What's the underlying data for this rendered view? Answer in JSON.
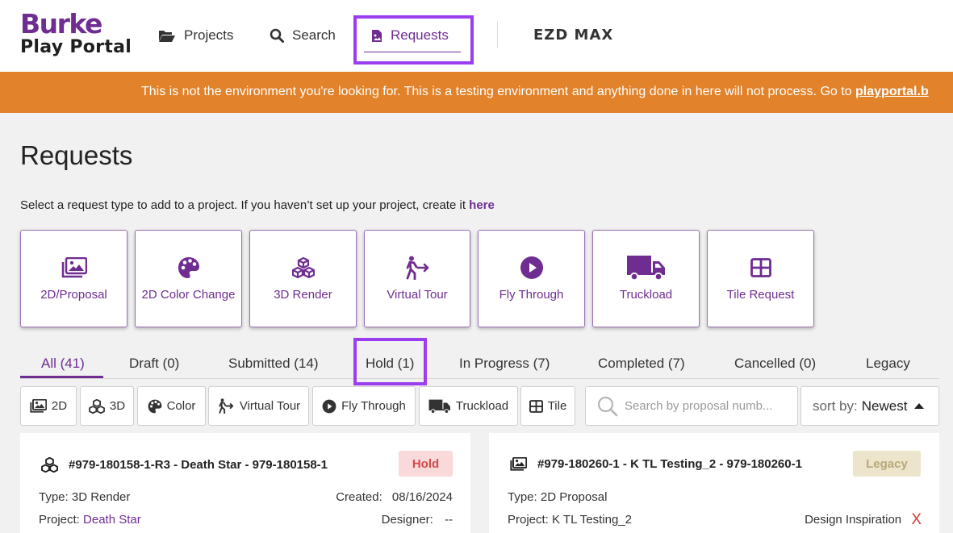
{
  "header": {
    "logo_top": "Burke",
    "logo_bottom": "Play Portal",
    "nav": {
      "projects": "Projects",
      "search": "Search",
      "requests": "Requests"
    },
    "partner_logo": "EZD MAX"
  },
  "banner": {
    "text": "This is not the environment you're looking for. This is a testing environment and anything done in here will not process. Go to ",
    "link": "playportal.b"
  },
  "page": {
    "title": "Requests",
    "intro_text": "Select a request type to add to a project. If you haven’t set up your project, create it ",
    "intro_link": "here"
  },
  "request_types": [
    {
      "label": "2D/Proposal",
      "icon": "image-gallery-icon"
    },
    {
      "label": "2D Color Change",
      "icon": "palette-icon"
    },
    {
      "label": "3D Render",
      "icon": "cubes-icon"
    },
    {
      "label": "Virtual Tour",
      "icon": "walking-person-icon"
    },
    {
      "label": "Fly Through",
      "icon": "play-circle-icon"
    },
    {
      "label": "Truckload",
      "icon": "truck-icon"
    },
    {
      "label": "Tile Request",
      "icon": "tile-grid-icon"
    }
  ],
  "tabs": [
    {
      "label": "All (41)",
      "active": true
    },
    {
      "label": "Draft (0)"
    },
    {
      "label": "Submitted (14)"
    },
    {
      "label": "Hold (1)"
    },
    {
      "label": "In Progress (7)"
    },
    {
      "label": "Completed (7)"
    },
    {
      "label": "Cancelled (0)"
    },
    {
      "label": "Legacy"
    }
  ],
  "filters": [
    {
      "label": "2D",
      "icon": "image-gallery-icon"
    },
    {
      "label": "3D",
      "icon": "cubes-icon"
    },
    {
      "label": "Color",
      "icon": "palette-icon"
    },
    {
      "label": "Virtual Tour",
      "icon": "walking-person-icon"
    },
    {
      "label": "Fly Through",
      "icon": "play-circle-icon"
    },
    {
      "label": "Truckload",
      "icon": "truck-icon"
    },
    {
      "label": "Tile",
      "icon": "tile-grid-icon"
    }
  ],
  "search": {
    "placeholder": "Search by proposal numb...",
    "value": ""
  },
  "sort": {
    "label": "sort by:",
    "value": "Newest"
  },
  "requests": [
    {
      "title": "#979-180158-1-R3 - Death Star - 979-180158-1",
      "status": "Hold",
      "type_label": "Type: 3D Render",
      "created_label": "Created:",
      "created_value": "08/16/2024",
      "project_label": "Project:",
      "project_value": "Death Star",
      "designer_label": "Designer:",
      "designer_value": "--"
    },
    {
      "title": "#979-180260-1 - K TL Testing_2 - 979-180260-1",
      "status": "Legacy",
      "type_label": "Type: 2D Proposal",
      "project_label": "Project:",
      "project_value": "K TL Testing_2",
      "design_inspiration_label": "Design Inspiration",
      "design_inspiration_mark": "X"
    }
  ],
  "colors": {
    "brand_purple": "#6f2c91",
    "highlight_purple": "#9b3ef0",
    "banner_orange": "#e2822a",
    "hold_text": "#d24b4b",
    "hold_bg": "#f9d9d9",
    "legacy_text": "#b9a779",
    "legacy_bg": "#ede4cc"
  }
}
